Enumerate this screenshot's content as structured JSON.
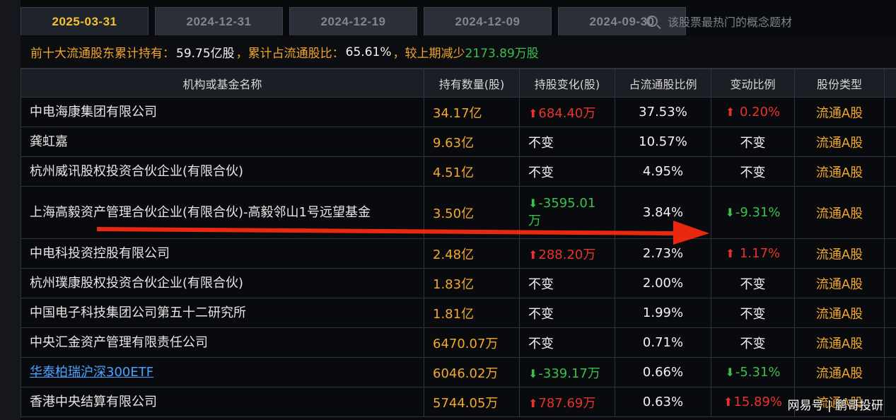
{
  "tabs": [
    {
      "label": "2025-03-31",
      "active": true
    },
    {
      "label": "2024-12-31",
      "active": false
    },
    {
      "label": "2024-12-19",
      "active": false
    },
    {
      "label": "2024-12-09",
      "active": false
    },
    {
      "label": "2024-09-30",
      "active": false
    }
  ],
  "search": {
    "placeholder": "该股票最热门的概念题材"
  },
  "summary": {
    "prefix": "前十大流通股东累计持有：",
    "total": "59.75亿股",
    "mid": "，累计占流通股比：",
    "pct": "65.61%",
    "suffix": "，较上期减少",
    "reduce": "2173.89万股"
  },
  "table": {
    "headers": [
      "机构或基金名称",
      "持有数量(股)",
      "持股变化(股)",
      "占流通股比例",
      "变动比例",
      "股份类型"
    ],
    "rows": [
      {
        "name": "中电海康集团有限公司",
        "qty": "34.17亿",
        "change": "684.40万",
        "change_dir": "up",
        "ratio": "37.53%",
        "var": "0.20%",
        "var_dir": "up",
        "type": "流通A股"
      },
      {
        "name": "龚虹嘉",
        "qty": "9.63亿",
        "change": "不变",
        "change_dir": "none",
        "ratio": "10.57%",
        "var": "不变",
        "var_dir": "none",
        "type": "流通A股"
      },
      {
        "name": "杭州威讯股权投资合伙企业(有限合伙)",
        "qty": "4.51亿",
        "change": "不变",
        "change_dir": "none",
        "ratio": "4.95%",
        "var": "不变",
        "var_dir": "none",
        "type": "流通A股"
      },
      {
        "name": "上海高毅资产管理合伙企业(有限合伙)-高毅邻山1号远望基金",
        "qty": "3.50亿",
        "change": "-3595.01万",
        "change_dir": "down",
        "ratio": "3.84%",
        "var": "-9.31%",
        "var_dir": "down",
        "type": "流通A股"
      },
      {
        "name": "中电科投资控股有限公司",
        "qty": "2.48亿",
        "change": "288.20万",
        "change_dir": "up",
        "ratio": "2.73%",
        "var": "1.17%",
        "var_dir": "up",
        "type": "流通A股"
      },
      {
        "name": "杭州璞康股权投资合伙企业(有限合伙)",
        "qty": "1.83亿",
        "change": "不变",
        "change_dir": "none",
        "ratio": "2.00%",
        "var": "不变",
        "var_dir": "none",
        "type": "流通A股"
      },
      {
        "name": "中国电子科技集团公司第五十二研究所",
        "qty": "1.81亿",
        "change": "不变",
        "change_dir": "none",
        "ratio": "1.99%",
        "var": "不变",
        "var_dir": "none",
        "type": "流通A股"
      },
      {
        "name": "中央汇金资产管理有限责任公司",
        "qty": "6470.07万",
        "change": "不变",
        "change_dir": "none",
        "ratio": "0.71%",
        "var": "不变",
        "var_dir": "none",
        "type": "流通A股"
      },
      {
        "name": "华泰柏瑞沪深300ETF",
        "qty": "6046.02万",
        "change": "-339.17万",
        "change_dir": "down",
        "ratio": "0.66%",
        "var": "-5.31%",
        "var_dir": "down",
        "type": "流通A股",
        "link": true
      },
      {
        "name": "香港中央结算有限公司",
        "qty": "5744.05万",
        "change": "787.69万",
        "change_dir": "up",
        "ratio": "0.63%",
        "var": "15.89%",
        "var_dir": "up",
        "type": "流通A股"
      }
    ]
  },
  "watermark": "网易号 | 鹏哥投研",
  "colors": {
    "accent": "#f2c230",
    "orange": "#f2a82c",
    "up": "#e8332a",
    "down": "#3cbf4b",
    "link": "#4aa3ff"
  }
}
